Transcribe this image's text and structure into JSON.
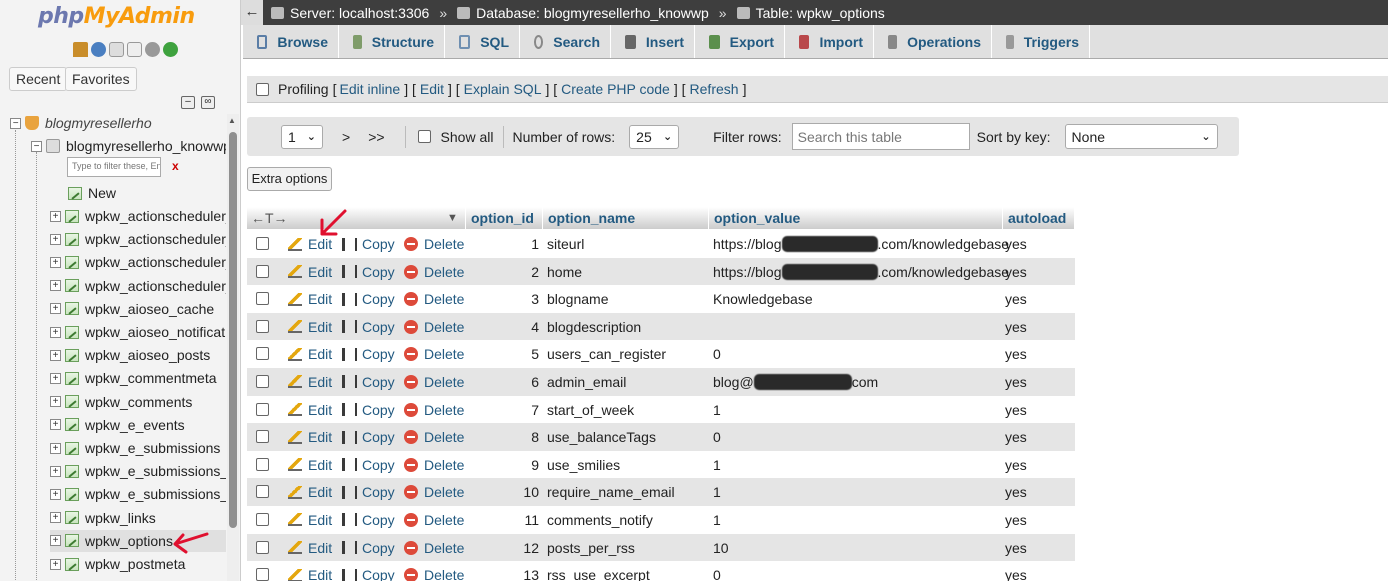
{
  "app": {
    "logo_php": "php",
    "logo_myadmin": "MyAdmin"
  },
  "nav": {
    "recent": "Recent",
    "favorites": "Favorites",
    "filter_placeholder": "Type to filter these, Enter to search all",
    "filter_clear": "x",
    "server_node": "blogmyresellerho",
    "database": "blogmyresellerho_knowwp",
    "new_label": "New",
    "tables": [
      "wpkw_actionscheduler_",
      "wpkw_actionscheduler_",
      "wpkw_actionscheduler_",
      "wpkw_actionscheduler_",
      "wpkw_aioseo_cache",
      "wpkw_aioseo_notificati",
      "wpkw_aioseo_posts",
      "wpkw_commentmeta",
      "wpkw_comments",
      "wpkw_e_events",
      "wpkw_e_submissions",
      "wpkw_e_submissions_",
      "wpkw_e_submissions_",
      "wpkw_links",
      "wpkw_options",
      "wpkw_postmeta"
    ]
  },
  "breadcrumb": {
    "server": "Server: localhost:3306",
    "database": "Database: blogmyresellerho_knowwp",
    "table": "Table: wpkw_options",
    "sep": "»"
  },
  "tabs": [
    "Browse",
    "Structure",
    "SQL",
    "Search",
    "Insert",
    "Export",
    "Import",
    "Operations",
    "Triggers"
  ],
  "profiling": {
    "label": "Profiling",
    "links": [
      "Edit inline",
      "Edit",
      "Explain SQL",
      "Create PHP code",
      "Refresh"
    ]
  },
  "navbar": {
    "page": "1",
    "next": ">",
    "last": ">>",
    "show_all": "Show all",
    "rows_label": "Number of rows:",
    "rows_value": "25",
    "filter_label": "Filter rows:",
    "filter_placeholder": "Search this table",
    "sort_label": "Sort by key:",
    "sort_value": "None"
  },
  "extra_options": "Extra options",
  "table": {
    "columns": [
      "option_id",
      "option_name",
      "option_value",
      "autoload"
    ],
    "actions": {
      "edit": "Edit",
      "copy": "Copy",
      "delete": "Delete"
    },
    "rows": [
      {
        "id": "1",
        "name": "siteurl",
        "value_pre": "https://blog",
        "value_post": ".com/knowledgebase",
        "autoload": "yes"
      },
      {
        "id": "2",
        "name": "home",
        "value_pre": "https://blog",
        "value_post": ".com/knowledgebase",
        "autoload": "yes"
      },
      {
        "id": "3",
        "name": "blogname",
        "value_pre": "Knowledgebase",
        "value_post": "",
        "autoload": "yes"
      },
      {
        "id": "4",
        "name": "blogdescription",
        "value_pre": "",
        "value_post": "",
        "autoload": "yes"
      },
      {
        "id": "5",
        "name": "users_can_register",
        "value_pre": "0",
        "value_post": "",
        "autoload": "yes"
      },
      {
        "id": "6",
        "name": "admin_email",
        "value_pre": "blog@",
        "value_post": "com",
        "autoload": "yes"
      },
      {
        "id": "7",
        "name": "start_of_week",
        "value_pre": "1",
        "value_post": "",
        "autoload": "yes"
      },
      {
        "id": "8",
        "name": "use_balanceTags",
        "value_pre": "0",
        "value_post": "",
        "autoload": "yes"
      },
      {
        "id": "9",
        "name": "use_smilies",
        "value_pre": "1",
        "value_post": "",
        "autoload": "yes"
      },
      {
        "id": "10",
        "name": "require_name_email",
        "value_pre": "1",
        "value_post": "",
        "autoload": "yes"
      },
      {
        "id": "11",
        "name": "comments_notify",
        "value_pre": "1",
        "value_post": "",
        "autoload": "yes"
      },
      {
        "id": "12",
        "name": "posts_per_rss",
        "value_pre": "10",
        "value_post": "",
        "autoload": "yes"
      },
      {
        "id": "13",
        "name": "rss_use_excerpt",
        "value_pre": "0",
        "value_post": "",
        "autoload": "yes"
      }
    ]
  },
  "colors": {
    "link": "#235a81",
    "annotation": "#e0102f"
  }
}
